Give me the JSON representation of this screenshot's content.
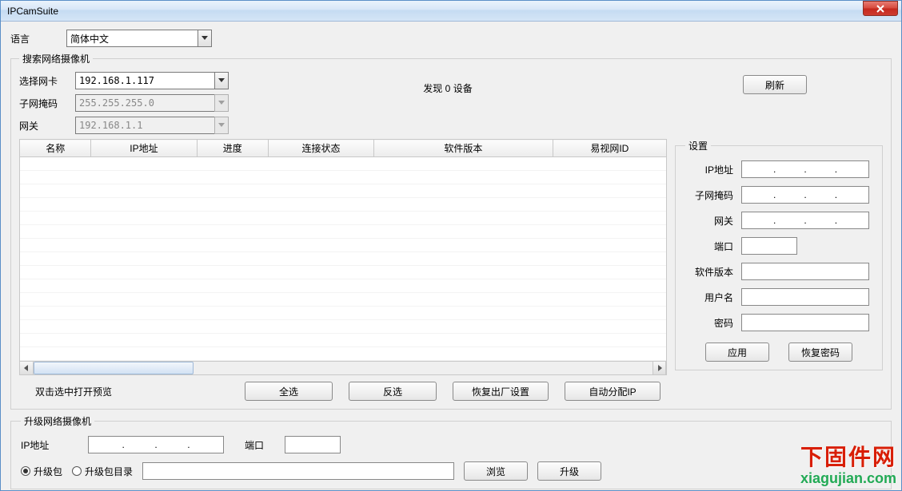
{
  "window": {
    "title": "IPCamSuite"
  },
  "language": {
    "label": "语言",
    "value": "简体中文"
  },
  "search": {
    "legend": "搜索网络摄像机",
    "nic_label": "选择网卡",
    "nic_value": "192.168.1.117",
    "subnet_label": "子网掩码",
    "subnet_value": "255.255.255.0",
    "gateway_label": "网关",
    "gateway_value": "192.168.1.1",
    "found_prefix": "发现",
    "found_count": "0",
    "found_suffix": "设备",
    "refresh": "刷新",
    "columns": [
      "名称",
      "IP地址",
      "进度",
      "连接状态",
      "软件版本",
      "易视网ID"
    ],
    "hint": "双击选中打开预览",
    "select_all": "全选",
    "invert": "反选",
    "factory_reset": "恢复出厂设置",
    "auto_ip": "自动分配IP"
  },
  "settings": {
    "legend": "设置",
    "ip_label": "IP地址",
    "subnet_label": "子网掩码",
    "gateway_label": "网关",
    "port_label": "端口",
    "port_value": "",
    "version_label": "软件版本",
    "version_value": "",
    "user_label": "用户名",
    "user_value": "",
    "pass_label": "密码",
    "pass_value": "",
    "apply": "应用",
    "recover_pw": "恢复密码"
  },
  "upgrade": {
    "legend": "升级网络摄像机",
    "ip_label": "IP地址",
    "port_label": "端口",
    "port_value": "",
    "pkg_radio": "升级包",
    "dir_radio": "升级包目录",
    "path_value": "",
    "browse": "浏览",
    "upgrade_btn": "升级"
  },
  "watermark": {
    "cn": "下固件网",
    "en": "xiagujian.com"
  }
}
